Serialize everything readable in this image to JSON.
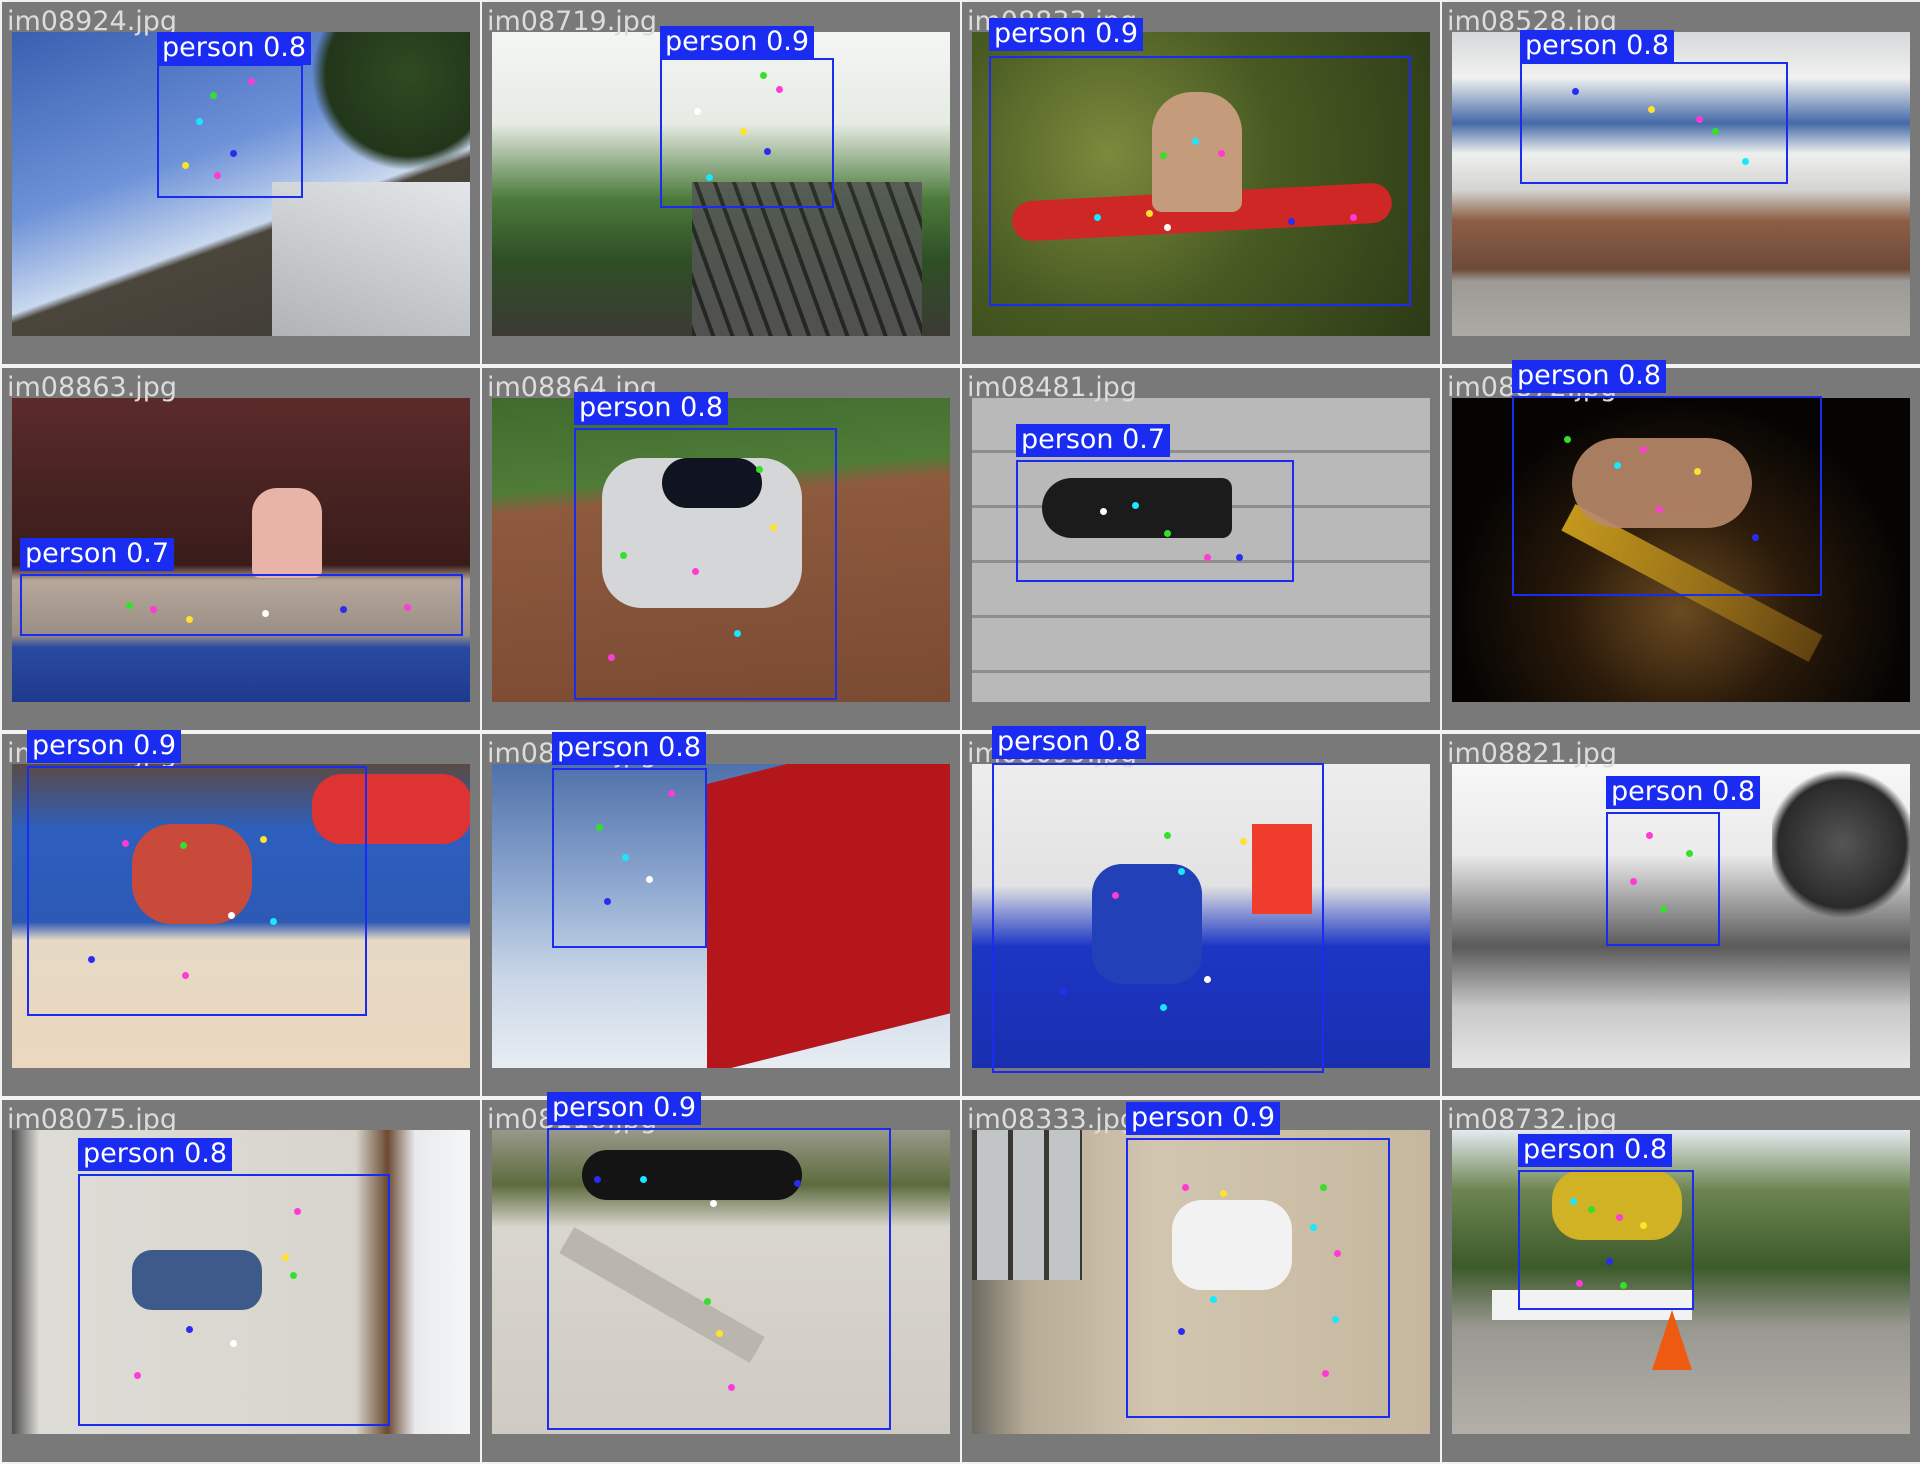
{
  "panels": [
    {
      "file": "im08924.jpg",
      "label": "person 0.8"
    },
    {
      "file": "im08719.jpg",
      "label": "person 0.9"
    },
    {
      "file": "im08833.jpg",
      "label": "person 0.9"
    },
    {
      "file": "im08528.jpg",
      "label": "person 0.8"
    },
    {
      "file": "im08863.jpg",
      "label": "person 0.7"
    },
    {
      "file": "im08864.jpg",
      "label": "person 0.8"
    },
    {
      "file": "im08481.jpg",
      "label": "person 0.7"
    },
    {
      "file": "im08872.jpg",
      "label": "person 0.8"
    },
    {
      "file": "im08946.jpg",
      "label": "person 0.9"
    },
    {
      "file": "im08012.jpg",
      "label": "person 0.8"
    },
    {
      "file": "im08099.jpg",
      "label": "person 0.8"
    },
    {
      "file": "im08821.jpg",
      "label": "person 0.8"
    },
    {
      "file": "im08075.jpg",
      "label": "person 0.8"
    },
    {
      "file": "im08116.jpg",
      "label": "person 0.9"
    },
    {
      "file": "im08333.jpg",
      "label": "person 0.9"
    },
    {
      "file": "im08732.jpg",
      "label": "person 0.8"
    }
  ],
  "colors": {
    "box": "#1a2cf2",
    "label_text": "#ffffff",
    "cell_bg": "#797979",
    "filename_text": "#dcdcdc",
    "keypoints": [
      "#ff3ad6",
      "#19e7ff",
      "#34e02a",
      "#2a2cf0",
      "#ffe22b",
      "#ffffff"
    ]
  }
}
